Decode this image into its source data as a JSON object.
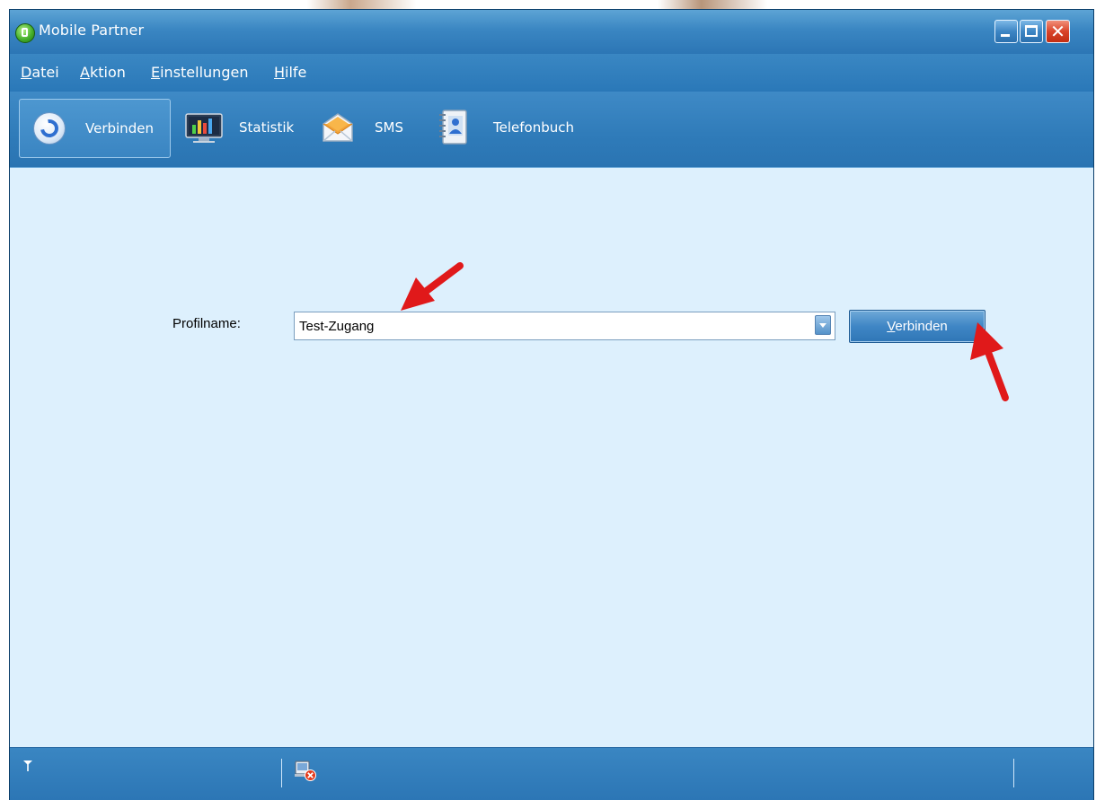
{
  "window": {
    "title": "Mobile Partner"
  },
  "menubar": {
    "items": [
      {
        "label": "Datei",
        "accel": "D",
        "rest": "atei"
      },
      {
        "label": "Aktion",
        "accel": "A",
        "rest": "ktion"
      },
      {
        "label": "Einstellungen",
        "accel": "E",
        "rest": "instellungen"
      },
      {
        "label": "Hilfe",
        "accel": "H",
        "rest": "ilfe"
      }
    ]
  },
  "toolbar": {
    "items": [
      {
        "label": "Verbinden",
        "icon": "connect-icon",
        "active": true
      },
      {
        "label": "Statistik",
        "icon": "statistics-icon"
      },
      {
        "label": "SMS",
        "icon": "sms-envelope-icon"
      },
      {
        "label": "Telefonbuch",
        "icon": "phonebook-icon"
      }
    ]
  },
  "main": {
    "profile_label": "Profilname:",
    "profile_value": "Test-Zugang",
    "connect_button": {
      "accel": "V",
      "rest": "erbinden"
    }
  },
  "colors": {
    "chrome_blue": "#2c76b5",
    "content_bg": "#ddf0fd",
    "annotation_red": "#e0191a"
  }
}
